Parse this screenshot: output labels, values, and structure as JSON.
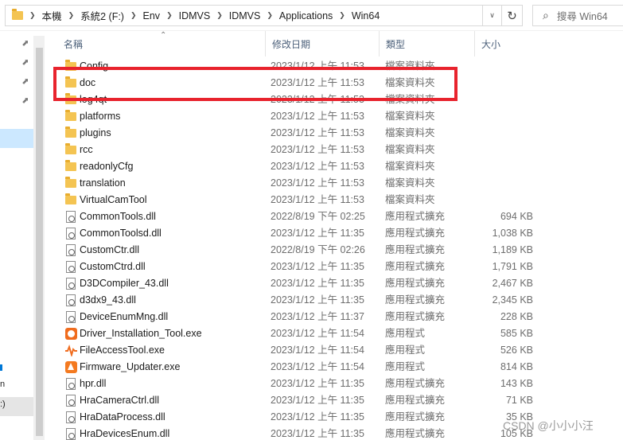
{
  "address_bar": {
    "crumbs": [
      "本機",
      "系統2 (F:)",
      "Env",
      "IDMVS",
      "IDMVS",
      "Applications",
      "Win64"
    ],
    "search_placeholder": "搜尋 Win64"
  },
  "icons": {
    "separator": "chevron-right-icon",
    "dropdown": "chevron-down-icon",
    "refresh": "refresh-icon",
    "search": "search-icon",
    "pin": "pin-icon"
  },
  "columns": {
    "name": "名稱",
    "date": "修改日期",
    "type": "類型",
    "size": "大小"
  },
  "left_pane": {
    "text_a": "n",
    "text_b": ":)"
  },
  "files": [
    {
      "name": "Config",
      "date": "2023/1/12 上午 11:53",
      "type": "檔案資料夾",
      "size": "",
      "icon": "folder"
    },
    {
      "name": "doc",
      "date": "2023/1/12 上午 11:53",
      "type": "檔案資料夾",
      "size": "",
      "icon": "folder"
    },
    {
      "name": "log4qt",
      "date": "2023/1/12 上午 11:53",
      "type": "檔案資料夾",
      "size": "",
      "icon": "folder"
    },
    {
      "name": "platforms",
      "date": "2023/1/12 上午 11:53",
      "type": "檔案資料夾",
      "size": "",
      "icon": "folder"
    },
    {
      "name": "plugins",
      "date": "2023/1/12 上午 11:53",
      "type": "檔案資料夾",
      "size": "",
      "icon": "folder"
    },
    {
      "name": "rcc",
      "date": "2023/1/12 上午 11:53",
      "type": "檔案資料夾",
      "size": "",
      "icon": "folder"
    },
    {
      "name": "readonlyCfg",
      "date": "2023/1/12 上午 11:53",
      "type": "檔案資料夾",
      "size": "",
      "icon": "folder"
    },
    {
      "name": "translation",
      "date": "2023/1/12 上午 11:53",
      "type": "檔案資料夾",
      "size": "",
      "icon": "folder"
    },
    {
      "name": "VirtualCamTool",
      "date": "2023/1/12 上午 11:53",
      "type": "檔案資料夾",
      "size": "",
      "icon": "folder"
    },
    {
      "name": "CommonTools.dll",
      "date": "2022/8/19 下午 02:25",
      "type": "應用程式擴充",
      "size": "694 KB",
      "icon": "dll"
    },
    {
      "name": "CommonToolsd.dll",
      "date": "2023/1/12 上午 11:35",
      "type": "應用程式擴充",
      "size": "1,038 KB",
      "icon": "dll"
    },
    {
      "name": "CustomCtr.dll",
      "date": "2022/8/19 下午 02:26",
      "type": "應用程式擴充",
      "size": "1,189 KB",
      "icon": "dll"
    },
    {
      "name": "CustomCtrd.dll",
      "date": "2023/1/12 上午 11:35",
      "type": "應用程式擴充",
      "size": "1,791 KB",
      "icon": "dll"
    },
    {
      "name": "D3DCompiler_43.dll",
      "date": "2023/1/12 上午 11:35",
      "type": "應用程式擴充",
      "size": "2,467 KB",
      "icon": "dll"
    },
    {
      "name": "d3dx9_43.dll",
      "date": "2023/1/12 上午 11:35",
      "type": "應用程式擴充",
      "size": "2,345 KB",
      "icon": "dll"
    },
    {
      "name": "DeviceEnumMng.dll",
      "date": "2023/1/12 上午 11:37",
      "type": "應用程式擴充",
      "size": "228 KB",
      "icon": "dll"
    },
    {
      "name": "Driver_Installation_Tool.exe",
      "date": "2023/1/12 上午 11:54",
      "type": "應用程式",
      "size": "585 KB",
      "icon": "driver-tool"
    },
    {
      "name": "FileAccessTool.exe",
      "date": "2023/1/12 上午 11:54",
      "type": "應用程式",
      "size": "526 KB",
      "icon": "pulse"
    },
    {
      "name": "Firmware_Updater.exe",
      "date": "2023/1/12 上午 11:54",
      "type": "應用程式",
      "size": "814 KB",
      "icon": "updater"
    },
    {
      "name": "hpr.dll",
      "date": "2023/1/12 上午 11:35",
      "type": "應用程式擴充",
      "size": "143 KB",
      "icon": "dll"
    },
    {
      "name": "HraCameraCtrl.dll",
      "date": "2023/1/12 上午 11:35",
      "type": "應用程式擴充",
      "size": "71 KB",
      "icon": "dll"
    },
    {
      "name": "HraDataProcess.dll",
      "date": "2023/1/12 上午 11:35",
      "type": "應用程式擴充",
      "size": "35 KB",
      "icon": "dll"
    },
    {
      "name": "HraDevicesEnum.dll",
      "date": "2023/1/12 上午 11:35",
      "type": "應用程式擴充",
      "size": "105 KB",
      "icon": "dll"
    }
  ],
  "annotation": {
    "color": "#e8232d"
  },
  "watermark": "CSDN @小小小汪"
}
